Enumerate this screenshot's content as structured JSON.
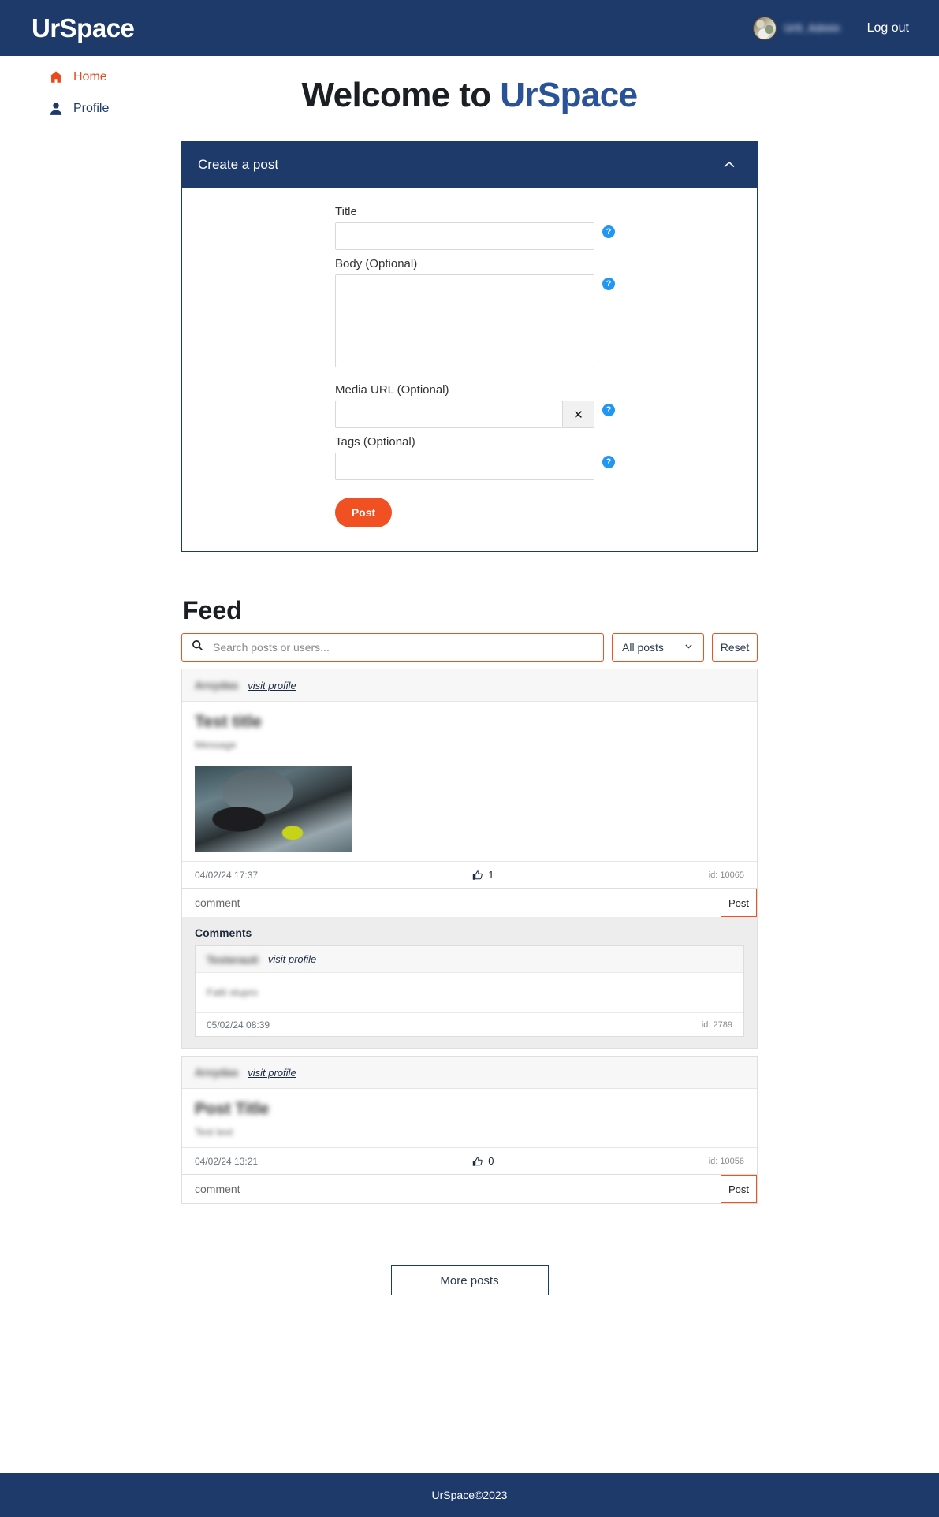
{
  "navbar": {
    "brand": "UrSpace",
    "username": "UrS_Admin",
    "logout_label": "Log out"
  },
  "sidebar": {
    "items": [
      {
        "label": "Home",
        "icon": "home-icon",
        "active": true
      },
      {
        "label": "Profile",
        "icon": "person-icon",
        "active": false
      }
    ]
  },
  "main": {
    "title_prefix": "Welcome to ",
    "title_accent": "UrSpace",
    "accent_color": "#2a5298"
  },
  "create_post": {
    "header": "Create a post",
    "collapse_icon": "chevron-up-icon",
    "fields": {
      "title_label": "Title",
      "title_value": "",
      "body_label": "Body (Optional)",
      "body_value": "",
      "media_label": "Media URL (Optional)",
      "media_value": "",
      "media_clear_icon": "close-icon",
      "tags_label": "Tags (Optional)",
      "tags_value": ""
    },
    "help_icon_glyph": "?",
    "submit_label": "Post",
    "submit_color": "#f05022"
  },
  "feed": {
    "heading": "Feed",
    "search": {
      "icon": "search-icon",
      "placeholder": "Search posts or users...",
      "value": ""
    },
    "filter": {
      "selected": "All posts",
      "icon": "chevron-down-icon"
    },
    "reset_label": "Reset",
    "border_color": "#f05022",
    "posts": [
      {
        "author": "Arvydas",
        "visit_label": "visit profile",
        "title": "Test title",
        "body": "Message",
        "has_media": true,
        "timestamp": "04/02/24 17:37",
        "likes": "1",
        "like_icon": "thumbs-up-icon",
        "id_label": "id: 10065",
        "comment_placeholder": "comment",
        "comment_post_label": "Post",
        "comments_label": "Comments",
        "comments": [
          {
            "author": "Testerauti",
            "visit_label": "visit profile",
            "text": "Fatti stupro",
            "timestamp": "05/02/24 08:39",
            "id_label": "id: 2789"
          }
        ]
      },
      {
        "author": "Arvydas",
        "visit_label": "visit profile",
        "title": "Post Title",
        "body": "Test text",
        "has_media": false,
        "timestamp": "04/02/24 13:21",
        "likes": "0",
        "like_icon": "thumbs-up-icon",
        "id_label": "id: 10056",
        "comment_placeholder": "comment",
        "comment_post_label": "Post",
        "comments_label": "",
        "comments": []
      }
    ],
    "more_label": "More posts"
  },
  "footer": {
    "text": "UrSpace©2023"
  }
}
